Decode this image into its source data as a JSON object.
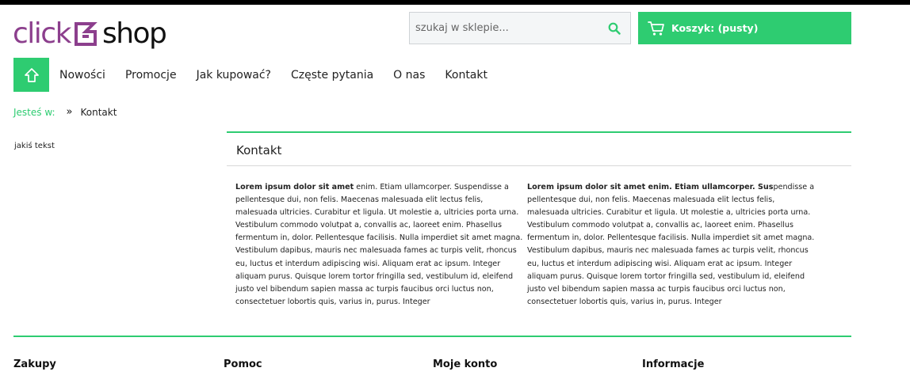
{
  "logo": {
    "part1": "click",
    "part2": "shop"
  },
  "search": {
    "placeholder": "szukaj w sklepie..."
  },
  "cart": {
    "label": "Koszyk: (pusty)"
  },
  "nav": {
    "items": [
      "Nowości",
      "Promocje",
      "Jak kupować?",
      "Częste pytania",
      "O nas",
      "Kontakt"
    ]
  },
  "breadcrumb": {
    "label": "Jesteś w:",
    "separator": "»",
    "current": "Kontakt"
  },
  "sidebar": {
    "text": "jakiś tekst"
  },
  "content": {
    "title": "Kontakt",
    "col1_bold": "Lorem ipsum dolor sit amet",
    "col1_rest": " enim. Etiam ullamcorper. Suspendisse a pellentesque dui, non felis. Maecenas malesuada elit lectus felis, malesuada ultricies. Curabitur et ligula. Ut molestie a, ultricies porta urna. Vestibulum commodo volutpat a, convallis ac, laoreet enim. Phasellus fermentum in, dolor. Pellentesque facilisis. Nulla imperdiet sit amet magna. Vestibulum dapibus, mauris nec malesuada fames ac turpis velit, rhoncus eu, luctus et interdum adipiscing wisi. Aliquam erat ac ipsum. Integer aliquam purus. Quisque lorem tortor fringilla sed, vestibulum id, eleifend justo vel bibendum sapien massa ac turpis faucibus orci luctus non, consectetuer lobortis quis, varius in, purus. Integer",
    "col2_bold": "Lorem ipsum dolor sit amet enim. Etiam ullamcorper. Sus",
    "col2_rest": "pendisse a pellentesque dui, non felis. Maecenas malesuada elit lectus felis, malesuada ultricies. Curabitur et ligula. Ut molestie a, ultricies porta urna. Vestibulum commodo volutpat a, convallis ac, laoreet enim. Phasellus fermentum in, dolor. Pellentesque facilisis. Nulla imperdiet sit amet magna. Vestibulum dapibus, mauris nec malesuada fames ac turpis velit, rhoncus eu, luctus et interdum adipiscing wisi. Aliquam erat ac ipsum. Integer aliquam purus. Quisque lorem tortor fringilla sed, vestibulum id, eleifend justo vel bibendum sapien massa ac turpis faucibus orci luctus non, consectetuer lobortis quis, varius in, purus. Integer"
  },
  "footer": {
    "headings": [
      "Zakupy",
      "Pomoc",
      "Moje konto",
      "Informacje"
    ]
  },
  "colors": {
    "accent": "#2ecc71",
    "brand": "#8c3f8d"
  },
  "icons": {
    "search": "search-icon",
    "cart": "cart-icon",
    "home": "home-icon",
    "logo": "logo-mark-icon"
  }
}
